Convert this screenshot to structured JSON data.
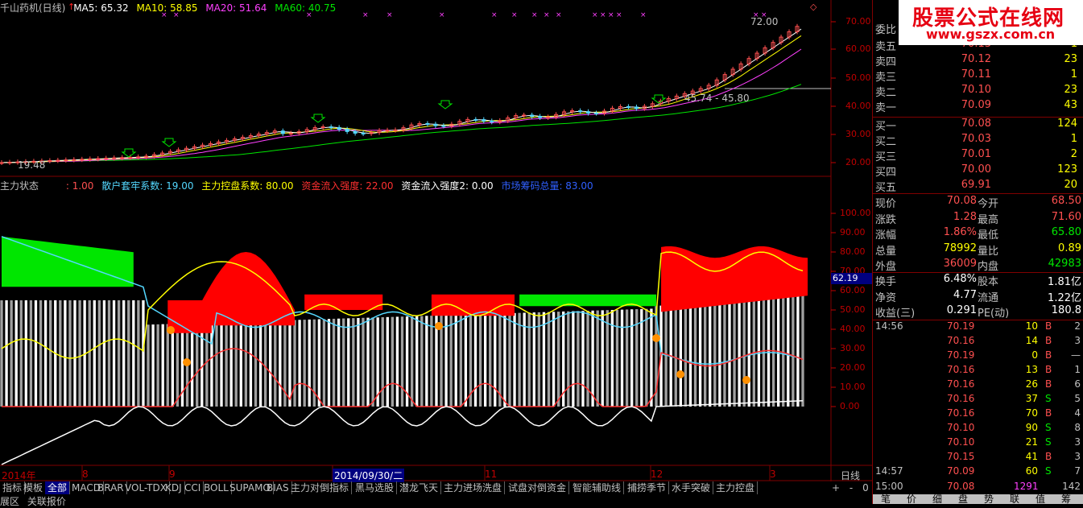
{
  "header": {
    "title": "千山药机(日线)",
    "ma5": "MA5: 65.32",
    "ma10": "MA10: 58.85",
    "ma20": "MA20: 51.64",
    "ma60": "MA60: 40.75"
  },
  "price_axis": [
    "70.00",
    "60.00",
    "50.00",
    "40.00",
    "30.00",
    "20.00"
  ],
  "annotations": {
    "high": "72.00",
    "range": "45.74 - 45.80",
    "low": "19.48"
  },
  "indicator_header": {
    "name": "主力状态",
    "v1": ": 1.00",
    "v2": "散户套牢系数: 19.00",
    "v3": "主力控盘系数: 80.00",
    "v4": "资金流入强度: 22.00",
    "v5": "资金流入强度2: 0.00",
    "v6": "市场筹码总量: 83.00"
  },
  "ind_axis": [
    "100.00",
    "90.00",
    "80.00",
    "70.00",
    "60.00",
    "50.00",
    "40.00",
    "30.00",
    "20.00",
    "10.00",
    "0.00"
  ],
  "ind_marker": "62.19",
  "dates": {
    "year": "2014年",
    "m8": "8",
    "m9": "9",
    "cursor": "2014/09/30/二",
    "m11": "11",
    "m12": "12",
    "m3": "3",
    "period": "日线"
  },
  "tabs": [
    "指标",
    "模板",
    "全部",
    "MACD",
    "BRAR",
    "VOL-TDX",
    "KDJ",
    "CCI",
    "BOLL",
    "SUPAMO",
    "BIAS",
    "主力对倒指标",
    "黑马选股",
    "潜龙飞天",
    "主力进场洗盘",
    "试盘对倒资金",
    "智能辅助线",
    "捕捞季节",
    "水手突破",
    "主力控盘"
  ],
  "tab_controls": [
    "+",
    "-",
    "0"
  ],
  "bottom_left": [
    "展区",
    "关联报价"
  ],
  "watermark": {
    "line1": "股票公式在线网",
    "line2": "www.gszx.com.cn"
  },
  "order_book": {
    "weibi_label": "委比",
    "sells": [
      {
        "label": "卖五",
        "price": "70.13",
        "vol": "1"
      },
      {
        "label": "卖四",
        "price": "70.12",
        "vol": "23"
      },
      {
        "label": "卖三",
        "price": "70.11",
        "vol": "1"
      },
      {
        "label": "卖二",
        "price": "70.10",
        "vol": "23"
      },
      {
        "label": "卖一",
        "price": "70.09",
        "vol": "43"
      }
    ],
    "buys": [
      {
        "label": "买一",
        "price": "70.08",
        "vol": "124"
      },
      {
        "label": "买二",
        "price": "70.03",
        "vol": "1"
      },
      {
        "label": "买三",
        "price": "70.01",
        "vol": "2"
      },
      {
        "label": "买四",
        "price": "70.00",
        "vol": "123"
      },
      {
        "label": "买五",
        "price": "69.91",
        "vol": "20"
      }
    ]
  },
  "quote": [
    {
      "k1": "现价",
      "v1": "70.08",
      "k2": "今开",
      "v2": "68.50"
    },
    {
      "k1": "涨跌",
      "v1": "1.28",
      "k2": "最高",
      "v2": "71.60"
    },
    {
      "k1": "涨幅",
      "v1": "1.86%",
      "k2": "最低",
      "v2": "65.80"
    },
    {
      "k1": "总量",
      "v1": "78992",
      "k2": "量比",
      "v2": "0.89"
    },
    {
      "k1": "外盘",
      "v1": "36009",
      "k2": "内盘",
      "v2": "42983"
    }
  ],
  "stats": [
    {
      "k1": "换手",
      "v1": "6.48%",
      "k2": "股本",
      "v2": "1.81亿"
    },
    {
      "k1": "净资",
      "v1": "4.77",
      "k2": "流通",
      "v2": "1.22亿"
    },
    {
      "k1": "收益(三)",
      "v1": "0.291",
      "k2": "PE(动)",
      "v2": "180.8"
    }
  ],
  "ticks": [
    {
      "t": "14:56",
      "p": "70.19",
      "v": "10",
      "s": "B",
      "n": "2"
    },
    {
      "t": "",
      "p": "70.16",
      "v": "14",
      "s": "B",
      "n": "3"
    },
    {
      "t": "",
      "p": "70.19",
      "v": "0",
      "s": "B",
      "n": "—"
    },
    {
      "t": "",
      "p": "70.16",
      "v": "13",
      "s": "B",
      "n": "1"
    },
    {
      "t": "",
      "p": "70.16",
      "v": "26",
      "s": "B",
      "n": "6"
    },
    {
      "t": "",
      "p": "70.16",
      "v": "37",
      "s": "S",
      "n": "5"
    },
    {
      "t": "",
      "p": "70.16",
      "v": "70",
      "s": "B",
      "n": "4"
    },
    {
      "t": "",
      "p": "70.10",
      "v": "90",
      "s": "S",
      "n": "8"
    },
    {
      "t": "",
      "p": "70.10",
      "v": "21",
      "s": "S",
      "n": "3"
    },
    {
      "t": "",
      "p": "70.15",
      "v": "41",
      "s": "B",
      "n": "3"
    },
    {
      "t": "14:57",
      "p": "70.09",
      "v": "60",
      "s": "S",
      "n": "7"
    },
    {
      "t": "15:00",
      "p": "70.08",
      "v": "1291",
      "s": "",
      "n": "142"
    }
  ],
  "bottom_tabs": [
    "笔",
    "价",
    "细",
    "盘",
    "势",
    "联",
    "值",
    "筹"
  ],
  "colors": {
    "red": "#ff5050",
    "green": "#00e600",
    "cyan": "#54d8ff",
    "yellow": "#ffff00",
    "magenta": "#ff40ff",
    "bg": "#000000"
  }
}
